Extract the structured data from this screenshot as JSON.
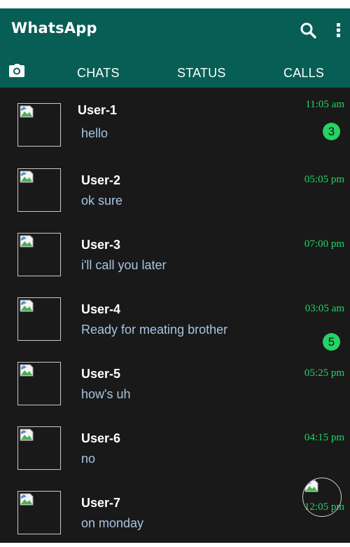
{
  "header": {
    "title": "WhatsApp",
    "background": "#075e54",
    "search_icon": "search-icon",
    "menu_icon": "more-vertical-icon"
  },
  "tabs": {
    "camera_icon": "camera-icon",
    "items": [
      {
        "label": "CHATS"
      },
      {
        "label": "STATUS"
      },
      {
        "label": "CALLS"
      }
    ]
  },
  "chats": [
    {
      "name": "User-1",
      "message": "hello",
      "time": "11:05 am",
      "unread": "3"
    },
    {
      "name": "User-2",
      "message": "ok sure",
      "time": "05:05 pm"
    },
    {
      "name": "User-3",
      "message": "i'll call you later",
      "time": "07:00 pm"
    },
    {
      "name": "User-4",
      "message": "Ready for meating brother",
      "time": "03:05 am",
      "unread": "5"
    },
    {
      "name": "User-5",
      "message": "how's uh",
      "time": "05:25 pm"
    },
    {
      "name": "User-6",
      "message": "no",
      "time": "04:15 pm"
    },
    {
      "name": "User-7",
      "message": "on monday",
      "time": "12:05 pm"
    }
  ],
  "colors": {
    "list_background": "#191919",
    "time": "#25d366",
    "badge": "#25d366",
    "message": "#a8c4e0"
  },
  "fab": {
    "icon": "broken-image-icon"
  }
}
